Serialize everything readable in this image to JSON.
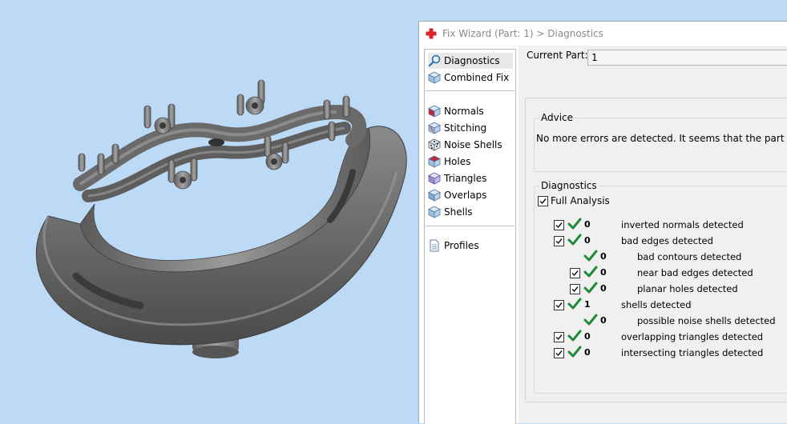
{
  "window": {
    "title": "Fix Wizard (Part: 1) > Diagnostics"
  },
  "nav": {
    "items": [
      {
        "label": "Diagnostics",
        "icon": "magnifier-icon"
      },
      {
        "label": "Combined Fix",
        "icon": "cube-icon"
      },
      {
        "label": "Normals",
        "icon": "normals-cube-icon"
      },
      {
        "label": "Stitching",
        "icon": "stitching-cube-icon"
      },
      {
        "label": "Noise Shells",
        "icon": "noise-shells-cube-icon"
      },
      {
        "label": "Holes",
        "icon": "holes-cube-icon"
      },
      {
        "label": "Triangles",
        "icon": "triangles-cube-icon"
      },
      {
        "label": "Overlaps",
        "icon": "overlaps-cube-icon"
      },
      {
        "label": "Shells",
        "icon": "shells-cube-icon"
      },
      {
        "label": "Profiles",
        "icon": "document-icon"
      }
    ]
  },
  "current_part": {
    "label": "Current Part:",
    "value": "1"
  },
  "advice": {
    "title": "Advice",
    "text": "No more errors are detected. It seems that the part is ok."
  },
  "diagnostics": {
    "title": "Diagnostics",
    "full_analysis_label": "Full Analysis",
    "rows": [
      {
        "count": "0",
        "label": "inverted normals detected"
      },
      {
        "count": "0",
        "label": "bad edges detected"
      },
      {
        "count": "0",
        "label": "bad contours detected"
      },
      {
        "count": "0",
        "label": "near bad edges detected"
      },
      {
        "count": "0",
        "label": "planar holes detected"
      },
      {
        "count": "1",
        "label": "shells detected"
      },
      {
        "count": "0",
        "label": "possible noise shells detected"
      },
      {
        "count": "0",
        "label": "overlapping triangles detected"
      },
      {
        "count": "0",
        "label": "intersecting triangles detected"
      }
    ]
  },
  "colors": {
    "viewport_bg": "#bcdaf6",
    "check_green": "#1f8a3b",
    "model_gray": "#6e6e6e"
  }
}
